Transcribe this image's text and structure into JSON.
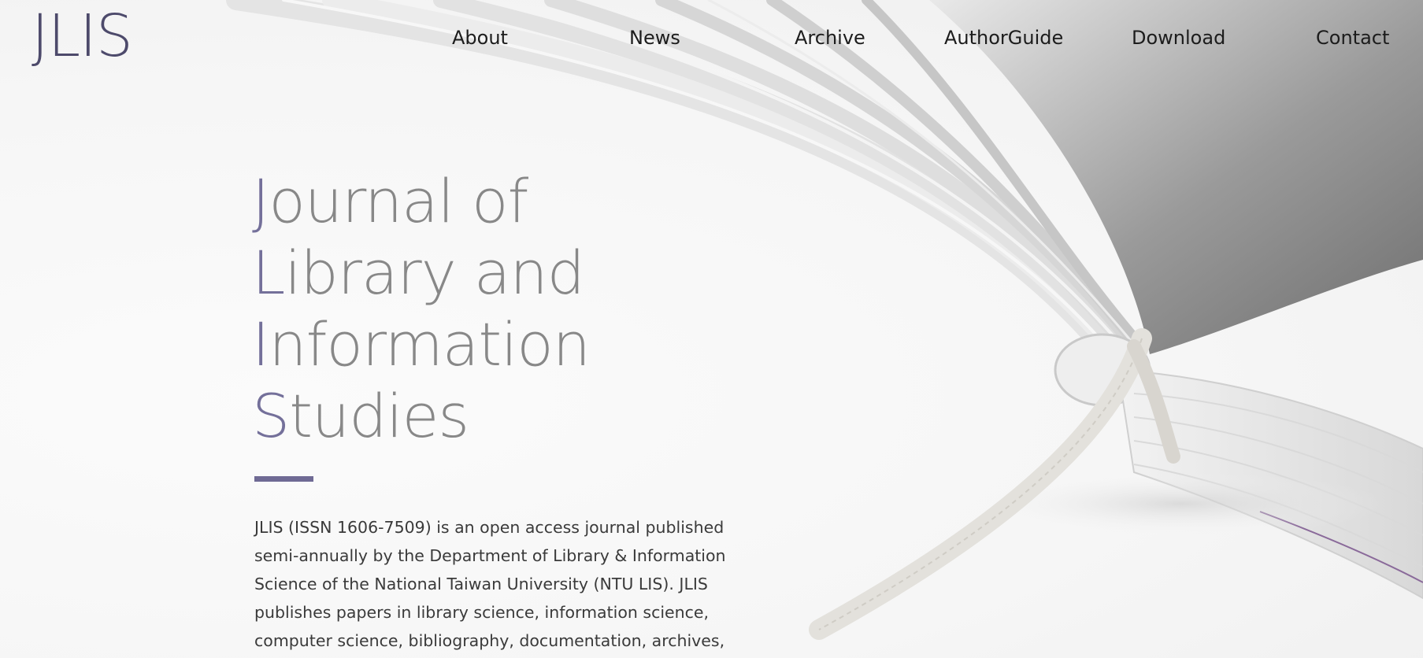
{
  "brand": {
    "logo_text": "JLIS"
  },
  "nav": {
    "items": [
      {
        "label": "About"
      },
      {
        "label": "News"
      },
      {
        "label": "Archive"
      },
      {
        "label": "AuthorGuide"
      },
      {
        "label": "Download"
      },
      {
        "label": "Contact"
      }
    ]
  },
  "hero": {
    "title_lines": [
      {
        "initial": "J",
        "rest": "ournal of"
      },
      {
        "initial": "L",
        "rest": "ibrary and"
      },
      {
        "initial": "I",
        "rest": "nformation"
      },
      {
        "initial": "S",
        "rest": "tudies"
      }
    ],
    "description": "JLIS (ISSN 1606-7509) is an open access journal published semi-annually by the Department of Library & Information Science of the National Taiwan University (NTU LIS). JLIS publishes papers in library science, information science, computer science, bibliography, documentation, archives,"
  },
  "colors": {
    "logo": "#4d4a6b",
    "title_initial": "#74709a",
    "title_text": "#888888",
    "accent_bar": "#6f6a94",
    "nav_text": "#1c1c1c",
    "body_text": "#3a3a3a"
  },
  "background": {
    "image_subject": "open-book-with-bookmark-ribbon"
  }
}
